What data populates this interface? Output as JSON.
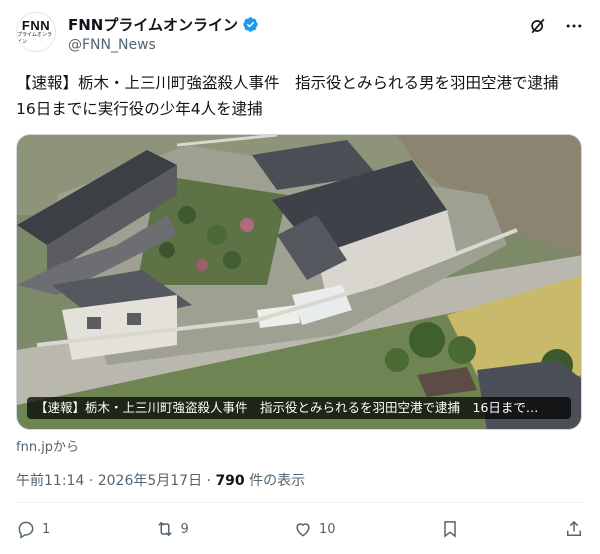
{
  "account": {
    "avatar_logo": "FNN",
    "avatar_sub": "プライムオンライン",
    "display_name": "FNNプライムオンライン",
    "handle": "@FNN_News",
    "verified": true
  },
  "header_icons": [
    "grok-icon",
    "more-icon"
  ],
  "tweet": {
    "text": "【速報】栃木・上三川町強盗殺人事件　指示役とみられる男を羽田空港で逮捕　16日までに実行役の少年4人を逮捕"
  },
  "card": {
    "caption": "【速報】栃木・上三川町強盗殺人事件　指示役とみられるを羽田空港で逮捕　16日まで…",
    "source": "fnn.jpから"
  },
  "meta": {
    "time": "午前11:14",
    "date": "2026年5月17日",
    "separator": "·",
    "views_count": "790",
    "views_label": "件の表示"
  },
  "actions": {
    "reply_count": "1",
    "retweet_count": "9",
    "like_count": "10"
  }
}
